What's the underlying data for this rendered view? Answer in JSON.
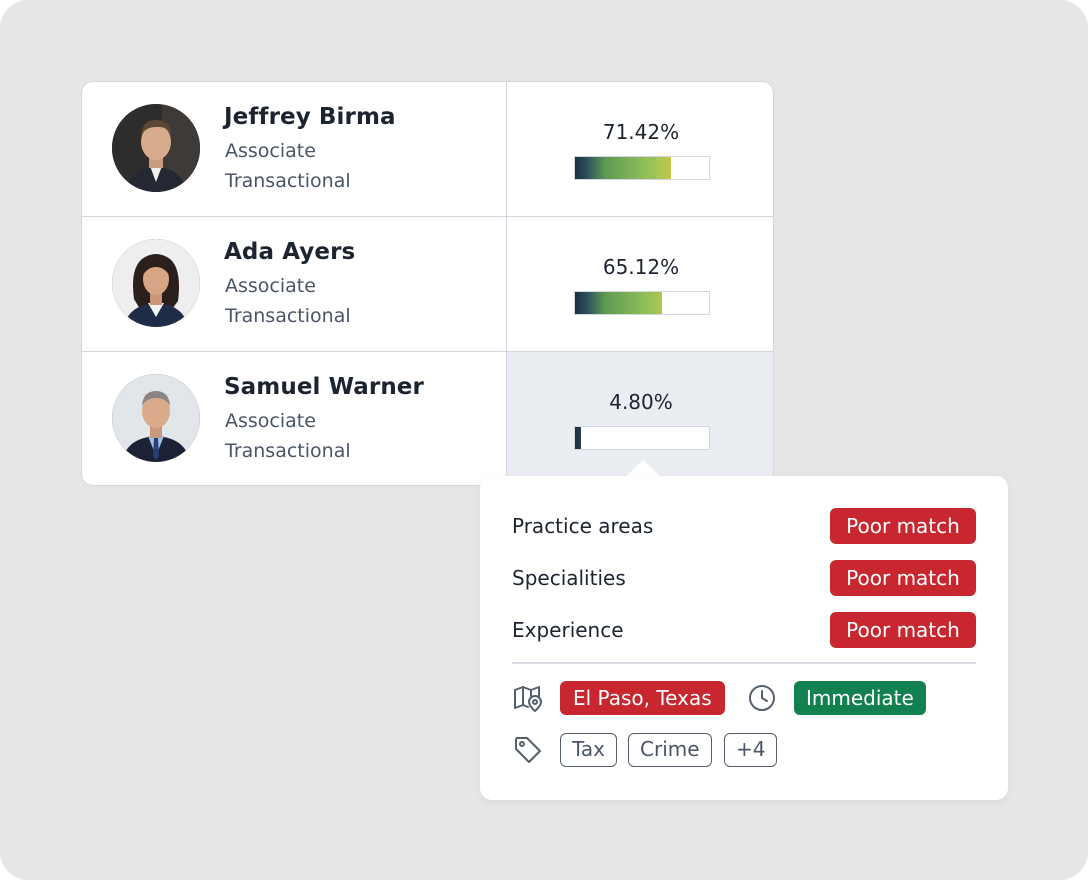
{
  "candidates": [
    {
      "name": "Jeffrey Birma",
      "role": "Associate",
      "department": "Transactional",
      "match_percent_label": "71.42%",
      "match_fraction": 0.7142
    },
    {
      "name": "Ada Ayers",
      "role": "Associate",
      "department": "Transactional",
      "match_percent_label": "65.12%",
      "match_fraction": 0.6512
    },
    {
      "name": "Samuel Warner",
      "role": "Associate",
      "department": "Transactional",
      "match_percent_label": "4.80%",
      "match_fraction": 0.048
    }
  ],
  "popover": {
    "criteria": [
      {
        "label": "Practice areas",
        "status": "Poor match"
      },
      {
        "label": "Specialities",
        "status": "Poor match"
      },
      {
        "label": "Experience",
        "status": "Poor match"
      }
    ],
    "location": "El Paso, Texas",
    "availability": "Immediate",
    "tags": [
      "Tax",
      "Crime",
      "+4"
    ],
    "icons": {
      "location": "map-pin-icon",
      "availability": "clock-icon",
      "tags": "tag-icon"
    }
  },
  "colors": {
    "poor": "#c8272f",
    "good": "#12804f",
    "selected_row": "#eaedf1"
  }
}
